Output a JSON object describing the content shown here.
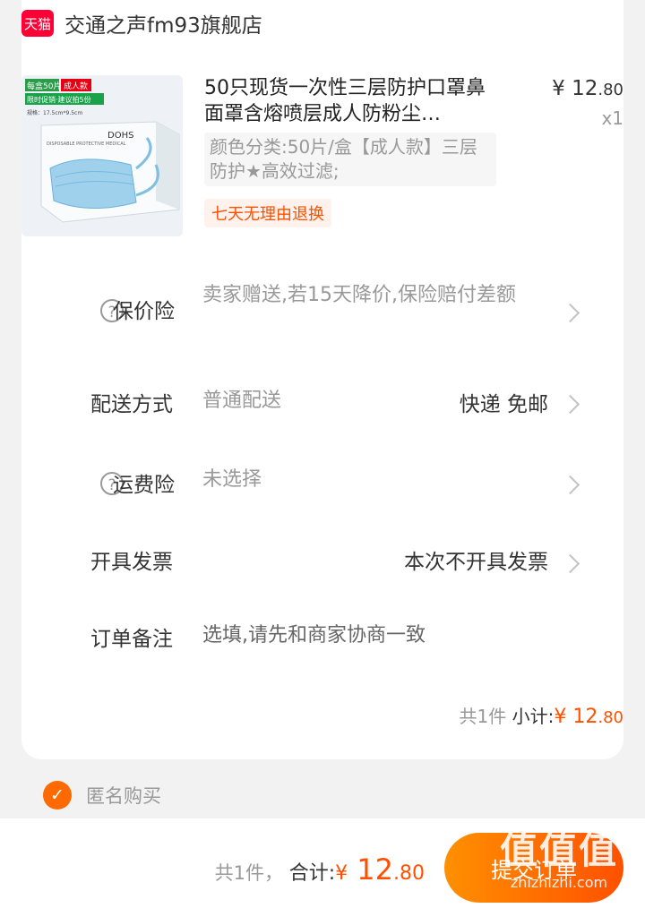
{
  "store": {
    "badge": "天猫",
    "name": "交通之声fm93旗舰店"
  },
  "product": {
    "title": "50只现货一次性三层防护口罩鼻面罩含熔喷层成人防粉尘…",
    "price_symbol": "¥",
    "price_int": "12",
    "price_dec": ".80",
    "quantity": "x1",
    "sku": "颜色分类:50片/盒【成人款】三层防护★高效过滤;",
    "tag": "七天无理由退换",
    "image": {
      "badge1": "每盒50片",
      "badge2": "成人款",
      "promo": "限时促销·建议拍5份",
      "spec": "规格：17.5cm*9.5cm",
      "brand": "DOHS",
      "box_text": "DISPOSABLE PROTECTIVE MEDICAL"
    }
  },
  "rows": {
    "insurance": {
      "label": "保价险",
      "value": "卖家赠送,若15天降价,保险赔付差额"
    },
    "delivery": {
      "label": "配送方式",
      "value": "普通配送",
      "right": "快递 免邮"
    },
    "shipping_insurance": {
      "label": "运费险",
      "value": "未选择"
    },
    "invoice": {
      "label": "开具发票",
      "right": "本次不开具发票"
    },
    "remark": {
      "label": "订单备注",
      "placeholder": "选填,请先和商家协商一致"
    }
  },
  "help_glyph": "?",
  "subtotal": {
    "count": "共1件",
    "label": "小计:",
    "symbol": "¥",
    "amount_int": "12",
    "amount_dec": ".80"
  },
  "anonymous": {
    "label": "匿名购买",
    "checked": true
  },
  "footer": {
    "count": "共1件，",
    "label": "合计:",
    "symbol": "¥",
    "amount_int": "12",
    "amount_dec": ".80",
    "submit": "提交订单"
  },
  "watermark": {
    "logo": "值值值",
    "url": "zhizhizhi.com"
  },
  "colors": {
    "accent": "#ff5000",
    "tmall": "#ff0036",
    "gradient_start": "#ff9000"
  }
}
